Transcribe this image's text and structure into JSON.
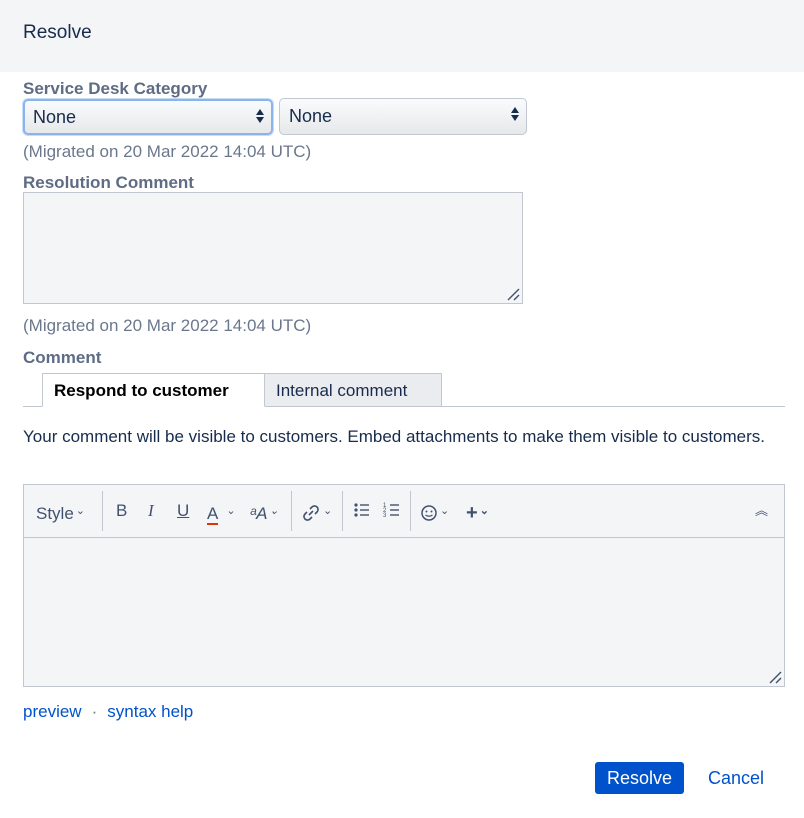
{
  "dialog": {
    "title": "Resolve"
  },
  "service_desk": {
    "label": "Service Desk Category",
    "select_1": "None",
    "select_2": "None",
    "migrated_note": "(Migrated on 20 Mar 2022 14:04 UTC)"
  },
  "resolution": {
    "label": "Resolution Comment",
    "value": "",
    "migrated_note": "(Migrated on 20 Mar 2022 14:04 UTC)"
  },
  "comment": {
    "label": "Comment",
    "tabs": [
      {
        "label": "Respond to customer",
        "active": true
      },
      {
        "label": "Internal comment",
        "active": false
      }
    ],
    "visibility_note": "Your comment will be visible to customers. Embed attachments to make them visible to customers.",
    "toolbar": {
      "style_label": "Style",
      "bold": "B",
      "italic": "I",
      "underline": "U",
      "text_color": "A",
      "text_color_accent": "#de350b",
      "font_size": "ᵃA",
      "icons": [
        "link-icon",
        "bullet-list-icon",
        "numbered-list-icon",
        "emoji-icon",
        "plus-icon",
        "collapse-icon"
      ]
    },
    "links": {
      "preview": "preview",
      "separator": "·",
      "syntax_help": "syntax help"
    }
  },
  "actions": {
    "resolve": "Resolve",
    "cancel": "Cancel"
  },
  "colors": {
    "primary": "#0052cc",
    "header_bg": "#f4f5f7"
  }
}
